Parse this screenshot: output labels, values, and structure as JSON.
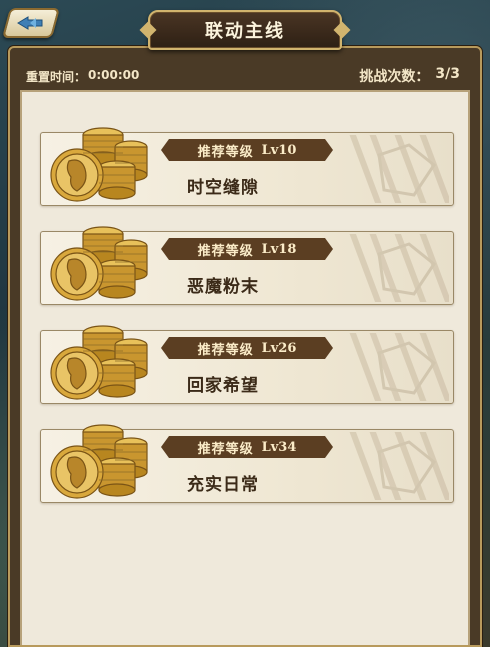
{
  "title": "联动主线",
  "reset": {
    "label": "重置时间：",
    "value": "0:00:00"
  },
  "tries": {
    "label": "挑战次数：",
    "value": "3/3"
  },
  "cards": [
    {
      "level_label": "推荐等级",
      "level": "Lv10",
      "name": "时空缝隙"
    },
    {
      "level_label": "推荐等级",
      "level": "Lv18",
      "name": "恶魔粉末"
    },
    {
      "level_label": "推荐等级",
      "level": "Lv26",
      "name": "回家希望"
    },
    {
      "level_label": "推荐等级",
      "level": "Lv34",
      "name": "充实日常"
    }
  ],
  "icons": {
    "back": "back-arrow-icon",
    "reward": "gold-coin-stack-icon"
  },
  "colors": {
    "banner": "#5b3e22",
    "panel": "#efe9db",
    "frame": "#4a3a26",
    "gold": "#d1b46e"
  }
}
